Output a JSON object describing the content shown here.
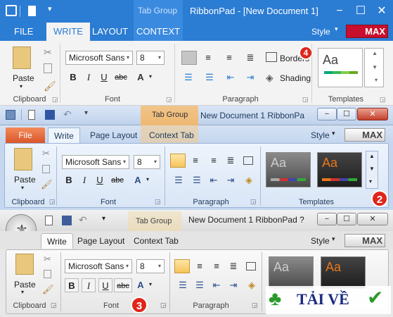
{
  "win1": {
    "title": "RibbonPad - [New Document 1]",
    "tab_group": "Tab Group",
    "tabs": [
      "FILE",
      "WRITE",
      "LAYOUT",
      "CONTEXT"
    ],
    "style_label": "Style",
    "style_value": "MAX",
    "font_name": "Microsoft Sans",
    "font_size": "8",
    "paste": "Paste",
    "borders": "Borders",
    "shading": "Shading",
    "groups": [
      "Clipboard",
      "Font",
      "Paragraph",
      "Templates"
    ]
  },
  "win2": {
    "title": "New Document 1 RibbonPa",
    "tab_group": "Tab Group",
    "tabs": [
      "File",
      "Write",
      "Page Layout",
      "Context Tab"
    ],
    "style_label": "Style",
    "style_value": "MAX",
    "font_name": "Microsoft Sans",
    "font_size": "8",
    "paste": "Paste",
    "groups": [
      "Clipboard",
      "Font",
      "Paragraph",
      "Templates"
    ]
  },
  "win3": {
    "title": "New Document 1 RibbonPad ?",
    "tab_group": "Tab Group",
    "tabs": [
      "Write",
      "Page Layout",
      "Context Tab"
    ],
    "style_label": "Style",
    "style_value": "MAX",
    "font_name": "Microsoft Sans",
    "font_size": "8",
    "paste": "Paste",
    "groups": [
      "Clipboard",
      "Font",
      "Paragraph"
    ]
  },
  "badges": [
    "4",
    "2",
    "3"
  ],
  "watermark": "TẢI VỀ",
  "colors": {
    "office2013_blue": "#2b7cd3",
    "office2010_blue": "#c5d7ef",
    "badge_red": "#e0251b",
    "max_red": "#c8102e"
  }
}
